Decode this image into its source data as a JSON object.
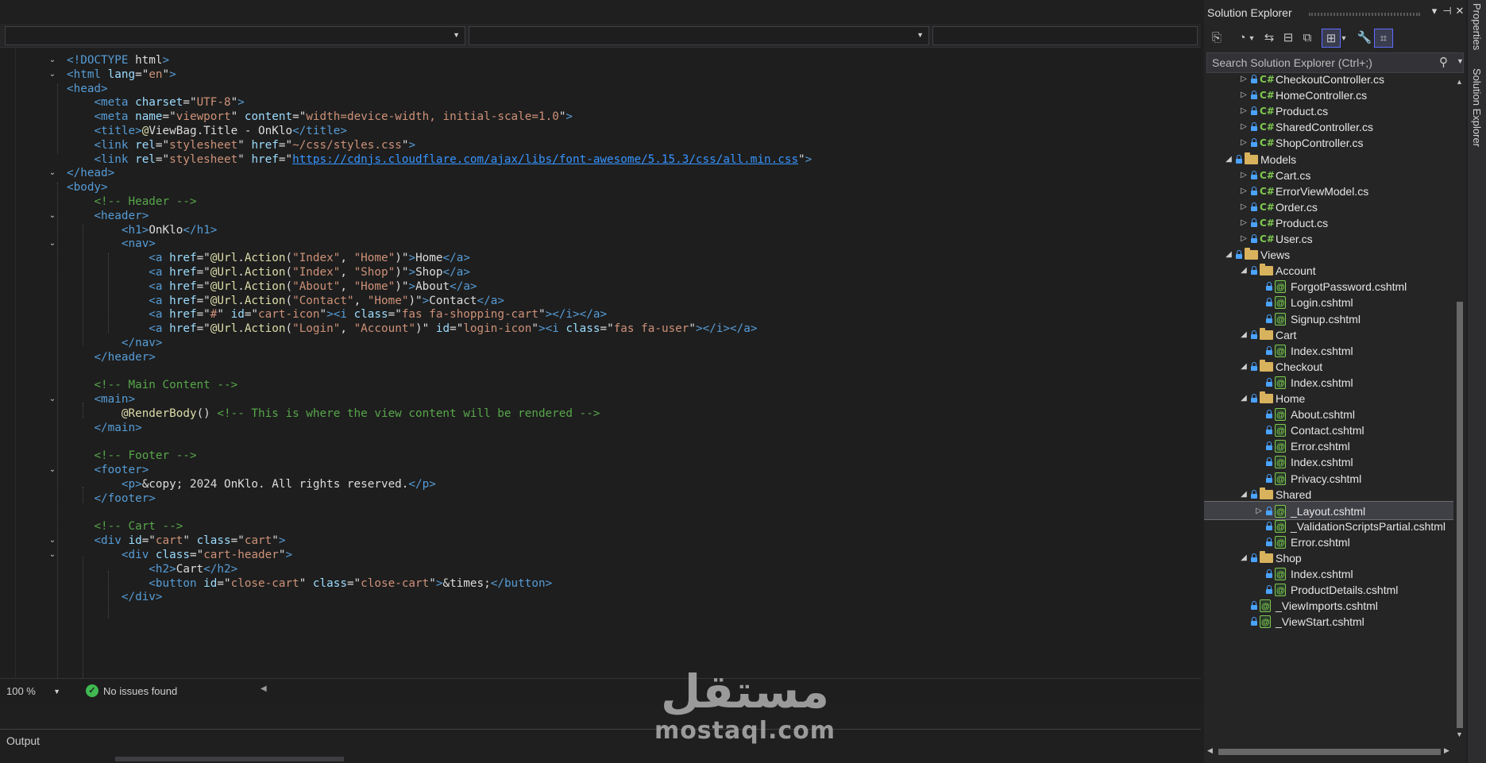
{
  "editor": {
    "nav_dropdowns": [
      "",
      "",
      ""
    ],
    "lines": [
      [
        [
          "t-tag",
          "<!DOCTYPE "
        ],
        [
          "t-txt",
          "html"
        ],
        [
          "t-tag",
          ">"
        ]
      ],
      [
        [
          "t-tag",
          "<html "
        ],
        [
          "t-attr",
          "lang"
        ],
        [
          "t-txt",
          "=\""
        ],
        [
          "t-str",
          "en"
        ],
        [
          "t-txt",
          "\""
        ],
        [
          "t-tag",
          ">"
        ]
      ],
      [
        [
          "t-tag",
          "<head>"
        ]
      ],
      [
        [
          "t-txt",
          "    "
        ],
        [
          "t-tag",
          "<meta "
        ],
        [
          "t-attr",
          "charset"
        ],
        [
          "t-txt",
          "=\""
        ],
        [
          "t-str",
          "UTF-8"
        ],
        [
          "t-txt",
          "\""
        ],
        [
          "t-tag",
          ">"
        ]
      ],
      [
        [
          "t-txt",
          "    "
        ],
        [
          "t-tag",
          "<meta "
        ],
        [
          "t-attr",
          "name"
        ],
        [
          "t-txt",
          "=\""
        ],
        [
          "t-str",
          "viewport"
        ],
        [
          "t-txt",
          "\" "
        ],
        [
          "t-attr",
          "content"
        ],
        [
          "t-txt",
          "=\""
        ],
        [
          "t-str",
          "width=device-width, initial-scale=1.0"
        ],
        [
          "t-txt",
          "\""
        ],
        [
          "t-tag",
          ">"
        ]
      ],
      [
        [
          "t-txt",
          "    "
        ],
        [
          "t-tag",
          "<title>"
        ],
        [
          "t-razor",
          "@"
        ],
        [
          "t-txt",
          "ViewBag.Title - OnKlo"
        ],
        [
          "t-tag",
          "</title>"
        ]
      ],
      [
        [
          "t-txt",
          "    "
        ],
        [
          "t-tag",
          "<link "
        ],
        [
          "t-attr",
          "rel"
        ],
        [
          "t-txt",
          "=\""
        ],
        [
          "t-str",
          "stylesheet"
        ],
        [
          "t-txt",
          "\" "
        ],
        [
          "t-attr",
          "href"
        ],
        [
          "t-txt",
          "=\""
        ],
        [
          "t-str",
          "~/css/styles.css"
        ],
        [
          "t-txt",
          "\""
        ],
        [
          "t-tag",
          ">"
        ]
      ],
      [
        [
          "t-txt",
          "    "
        ],
        [
          "t-tag",
          "<link "
        ],
        [
          "t-attr",
          "rel"
        ],
        [
          "t-txt",
          "=\""
        ],
        [
          "t-str",
          "stylesheet"
        ],
        [
          "t-txt",
          "\" "
        ],
        [
          "t-attr",
          "href"
        ],
        [
          "t-txt",
          "=\""
        ],
        [
          "t-link",
          "https://cdnjs.cloudflare.com/ajax/libs/font-awesome/5.15.3/css/all.min.css"
        ],
        [
          "t-txt",
          "\""
        ],
        [
          "t-tag",
          ">"
        ]
      ],
      [
        [
          "t-tag",
          "</head>"
        ]
      ],
      [
        [
          "t-tag",
          "<body>"
        ]
      ],
      [
        [
          "t-txt",
          "    "
        ],
        [
          "t-com",
          "<!-- Header -->"
        ]
      ],
      [
        [
          "t-txt",
          "    "
        ],
        [
          "t-tag",
          "<header>"
        ]
      ],
      [
        [
          "t-txt",
          "        "
        ],
        [
          "t-tag",
          "<h1>"
        ],
        [
          "t-txt",
          "OnKlo"
        ],
        [
          "t-tag",
          "</h1>"
        ]
      ],
      [
        [
          "t-txt",
          "        "
        ],
        [
          "t-tag",
          "<nav>"
        ]
      ],
      [
        [
          "t-txt",
          "            "
        ],
        [
          "t-tag",
          "<a "
        ],
        [
          "t-attr",
          "href"
        ],
        [
          "t-txt",
          "=\""
        ],
        [
          "t-razor",
          "@Url"
        ],
        [
          "t-txt",
          "."
        ],
        [
          "t-razor",
          "Action"
        ],
        [
          "t-txt",
          "("
        ],
        [
          "t-str",
          "\"Index\""
        ],
        [
          "t-txt",
          ", "
        ],
        [
          "t-str",
          "\"Home\""
        ],
        [
          "t-txt",
          ")\""
        ],
        [
          "t-tag",
          ">"
        ],
        [
          "t-txt",
          "Home"
        ],
        [
          "t-tag",
          "</a>"
        ]
      ],
      [
        [
          "t-txt",
          "            "
        ],
        [
          "t-tag",
          "<a "
        ],
        [
          "t-attr",
          "href"
        ],
        [
          "t-txt",
          "=\""
        ],
        [
          "t-razor",
          "@Url"
        ],
        [
          "t-txt",
          "."
        ],
        [
          "t-razor",
          "Action"
        ],
        [
          "t-txt",
          "("
        ],
        [
          "t-str",
          "\"Index\""
        ],
        [
          "t-txt",
          ", "
        ],
        [
          "t-str",
          "\"Shop\""
        ],
        [
          "t-txt",
          ")\""
        ],
        [
          "t-tag",
          ">"
        ],
        [
          "t-txt",
          "Shop"
        ],
        [
          "t-tag",
          "</a>"
        ]
      ],
      [
        [
          "t-txt",
          "            "
        ],
        [
          "t-tag",
          "<a "
        ],
        [
          "t-attr",
          "href"
        ],
        [
          "t-txt",
          "=\""
        ],
        [
          "t-razor",
          "@Url"
        ],
        [
          "t-txt",
          "."
        ],
        [
          "t-razor",
          "Action"
        ],
        [
          "t-txt",
          "("
        ],
        [
          "t-str",
          "\"About\""
        ],
        [
          "t-txt",
          ", "
        ],
        [
          "t-str",
          "\"Home\""
        ],
        [
          "t-txt",
          ")\""
        ],
        [
          "t-tag",
          ">"
        ],
        [
          "t-txt",
          "About"
        ],
        [
          "t-tag",
          "</a>"
        ]
      ],
      [
        [
          "t-txt",
          "            "
        ],
        [
          "t-tag",
          "<a "
        ],
        [
          "t-attr",
          "href"
        ],
        [
          "t-txt",
          "=\""
        ],
        [
          "t-razor",
          "@Url"
        ],
        [
          "t-txt",
          "."
        ],
        [
          "t-razor",
          "Action"
        ],
        [
          "t-txt",
          "("
        ],
        [
          "t-str",
          "\"Contact\""
        ],
        [
          "t-txt",
          ", "
        ],
        [
          "t-str",
          "\"Home\""
        ],
        [
          "t-txt",
          ")\""
        ],
        [
          "t-tag",
          ">"
        ],
        [
          "t-txt",
          "Contact"
        ],
        [
          "t-tag",
          "</a>"
        ]
      ],
      [
        [
          "t-txt",
          "            "
        ],
        [
          "t-tag",
          "<a "
        ],
        [
          "t-attr",
          "href"
        ],
        [
          "t-txt",
          "=\""
        ],
        [
          "t-str",
          "#"
        ],
        [
          "t-txt",
          "\" "
        ],
        [
          "t-attr",
          "id"
        ],
        [
          "t-txt",
          "=\""
        ],
        [
          "t-str",
          "cart-icon"
        ],
        [
          "t-txt",
          "\""
        ],
        [
          "t-tag",
          "><i "
        ],
        [
          "t-attr",
          "class"
        ],
        [
          "t-txt",
          "=\""
        ],
        [
          "t-str",
          "fas fa-shopping-cart"
        ],
        [
          "t-txt",
          "\""
        ],
        [
          "t-tag",
          "></i></a>"
        ]
      ],
      [
        [
          "t-txt",
          "            "
        ],
        [
          "t-tag",
          "<a "
        ],
        [
          "t-attr",
          "href"
        ],
        [
          "t-txt",
          "=\""
        ],
        [
          "t-razor",
          "@Url"
        ],
        [
          "t-txt",
          "."
        ],
        [
          "t-razor",
          "Action"
        ],
        [
          "t-txt",
          "("
        ],
        [
          "t-str",
          "\"Login\""
        ],
        [
          "t-txt",
          ", "
        ],
        [
          "t-str",
          "\"Account\""
        ],
        [
          "t-txt",
          ")\" "
        ],
        [
          "t-attr",
          "id"
        ],
        [
          "t-txt",
          "=\""
        ],
        [
          "t-str",
          "login-icon"
        ],
        [
          "t-txt",
          "\""
        ],
        [
          "t-tag",
          "><i "
        ],
        [
          "t-attr",
          "class"
        ],
        [
          "t-txt",
          "=\""
        ],
        [
          "t-str",
          "fas fa-user"
        ],
        [
          "t-txt",
          "\""
        ],
        [
          "t-tag",
          "></i></a>"
        ]
      ],
      [
        [
          "t-txt",
          "        "
        ],
        [
          "t-tag",
          "</nav>"
        ]
      ],
      [
        [
          "t-txt",
          "    "
        ],
        [
          "t-tag",
          "</header>"
        ]
      ],
      [
        [
          "t-txt",
          ""
        ]
      ],
      [
        [
          "t-txt",
          "    "
        ],
        [
          "t-com",
          "<!-- Main Content -->"
        ]
      ],
      [
        [
          "t-txt",
          "    "
        ],
        [
          "t-tag",
          "<main>"
        ]
      ],
      [
        [
          "t-txt",
          "        "
        ],
        [
          "t-razor",
          "@RenderBody"
        ],
        [
          "t-txt",
          "() "
        ],
        [
          "t-com",
          "<!-- This is where the view content will be rendered -->"
        ]
      ],
      [
        [
          "t-txt",
          "    "
        ],
        [
          "t-tag",
          "</main>"
        ]
      ],
      [
        [
          "t-txt",
          ""
        ]
      ],
      [
        [
          "t-txt",
          "    "
        ],
        [
          "t-com",
          "<!-- Footer -->"
        ]
      ],
      [
        [
          "t-txt",
          "    "
        ],
        [
          "t-tag",
          "<footer>"
        ]
      ],
      [
        [
          "t-txt",
          "        "
        ],
        [
          "t-tag",
          "<p>"
        ],
        [
          "t-txt",
          "&copy; 2024 OnKlo. All rights reserved."
        ],
        [
          "t-tag",
          "</p>"
        ]
      ],
      [
        [
          "t-txt",
          "    "
        ],
        [
          "t-tag",
          "</footer>"
        ]
      ],
      [
        [
          "t-txt",
          ""
        ]
      ],
      [
        [
          "t-txt",
          "    "
        ],
        [
          "t-com",
          "<!-- Cart -->"
        ]
      ],
      [
        [
          "t-txt",
          "    "
        ],
        [
          "t-tag",
          "<div "
        ],
        [
          "t-attr",
          "id"
        ],
        [
          "t-txt",
          "=\""
        ],
        [
          "t-str",
          "cart"
        ],
        [
          "t-txt",
          "\" "
        ],
        [
          "t-attr",
          "class"
        ],
        [
          "t-txt",
          "=\""
        ],
        [
          "t-str",
          "cart"
        ],
        [
          "t-txt",
          "\""
        ],
        [
          "t-tag",
          ">"
        ]
      ],
      [
        [
          "t-txt",
          "        "
        ],
        [
          "t-tag",
          "<div "
        ],
        [
          "t-attr",
          "class"
        ],
        [
          "t-txt",
          "=\""
        ],
        [
          "t-str",
          "cart-header"
        ],
        [
          "t-txt",
          "\""
        ],
        [
          "t-tag",
          ">"
        ]
      ],
      [
        [
          "t-txt",
          "            "
        ],
        [
          "t-tag",
          "<h2>"
        ],
        [
          "t-txt",
          "Cart"
        ],
        [
          "t-tag",
          "</h2>"
        ]
      ],
      [
        [
          "t-txt",
          "            "
        ],
        [
          "t-tag",
          "<button "
        ],
        [
          "t-attr",
          "id"
        ],
        [
          "t-txt",
          "=\""
        ],
        [
          "t-str",
          "close-cart"
        ],
        [
          "t-txt",
          "\" "
        ],
        [
          "t-attr",
          "class"
        ],
        [
          "t-txt",
          "=\""
        ],
        [
          "t-str",
          "close-cart"
        ],
        [
          "t-txt",
          "\""
        ],
        [
          "t-tag",
          ">"
        ],
        [
          "t-txt",
          "&times;"
        ],
        [
          "t-tag",
          "</button>"
        ]
      ],
      [
        [
          "t-txt",
          "        "
        ],
        [
          "t-tag",
          "</div>"
        ]
      ]
    ],
    "fold_markers": [
      "⌄",
      "⌄",
      "",
      "",
      "",
      "",
      "",
      "",
      "⌄",
      "",
      "",
      "⌄",
      "",
      "⌄",
      "",
      "",
      "",
      "",
      "",
      "",
      "",
      "",
      "",
      "",
      "⌄",
      "",
      "",
      "",
      "",
      "⌄",
      "",
      "",
      "",
      "",
      "⌄",
      "⌄",
      "",
      ""
    ],
    "zoom": "100 %",
    "status": "No issues found"
  },
  "output": {
    "title": "Output"
  },
  "solution_explorer": {
    "title": "Solution Explorer",
    "search_placeholder": "Search Solution Explorer (Ctrl+;)",
    "items": [
      {
        "label": "CheckoutController.cs",
        "type": "cs",
        "level": 2,
        "expander": "▷"
      },
      {
        "label": "HomeController.cs",
        "type": "cs",
        "level": 2,
        "expander": "▷"
      },
      {
        "label": "Product.cs",
        "type": "cs",
        "level": 2,
        "expander": "▷",
        "pending": true
      },
      {
        "label": "SharedController.cs",
        "type": "cs",
        "level": 2,
        "expander": "▷"
      },
      {
        "label": "ShopController.cs",
        "type": "cs",
        "level": 2,
        "expander": "▷"
      },
      {
        "label": "Models",
        "type": "folder",
        "level": 1,
        "expander": "◢"
      },
      {
        "label": "Cart.cs",
        "type": "cs",
        "level": 2,
        "expander": "▷"
      },
      {
        "label": "ErrorViewModel.cs",
        "type": "cs",
        "level": 2,
        "expander": "▷"
      },
      {
        "label": "Order.cs",
        "type": "cs",
        "level": 2,
        "expander": "▷"
      },
      {
        "label": "Product.cs",
        "type": "cs",
        "level": 2,
        "expander": "▷"
      },
      {
        "label": "User.cs",
        "type": "cs",
        "level": 2,
        "expander": "▷"
      },
      {
        "label": "Views",
        "type": "folder",
        "level": 1,
        "expander": "◢"
      },
      {
        "label": "Account",
        "type": "folder",
        "level": 2,
        "expander": "◢"
      },
      {
        "label": "ForgotPassword.cshtml",
        "type": "cshtml",
        "level": 3,
        "expander": ""
      },
      {
        "label": "Login.cshtml",
        "type": "cshtml",
        "level": 3,
        "expander": ""
      },
      {
        "label": "Signup.cshtml",
        "type": "cshtml",
        "level": 3,
        "expander": ""
      },
      {
        "label": "Cart",
        "type": "folder",
        "level": 2,
        "expander": "◢"
      },
      {
        "label": "Index.cshtml",
        "type": "cshtml",
        "level": 3,
        "expander": ""
      },
      {
        "label": "Checkout",
        "type": "folder",
        "level": 2,
        "expander": "◢"
      },
      {
        "label": "Index.cshtml",
        "type": "cshtml",
        "level": 3,
        "expander": ""
      },
      {
        "label": "Home",
        "type": "folder",
        "level": 2,
        "expander": "◢"
      },
      {
        "label": "About.cshtml",
        "type": "cshtml",
        "level": 3,
        "expander": ""
      },
      {
        "label": "Contact.cshtml",
        "type": "cshtml",
        "level": 3,
        "expander": ""
      },
      {
        "label": "Error.cshtml",
        "type": "cshtml",
        "level": 3,
        "expander": ""
      },
      {
        "label": "Index.cshtml",
        "type": "cshtml",
        "level": 3,
        "expander": ""
      },
      {
        "label": "Privacy.cshtml",
        "type": "cshtml",
        "level": 3,
        "expander": ""
      },
      {
        "label": "Shared",
        "type": "folder",
        "level": 2,
        "expander": "◢"
      },
      {
        "label": "_Layout.cshtml",
        "type": "cshtml",
        "level": 3,
        "expander": "▷",
        "selected": true
      },
      {
        "label": "_ValidationScriptsPartial.cshtml",
        "type": "cshtml",
        "level": 3,
        "expander": ""
      },
      {
        "label": "Error.cshtml",
        "type": "cshtml",
        "level": 3,
        "expander": ""
      },
      {
        "label": "Shop",
        "type": "folder",
        "level": 2,
        "expander": "◢"
      },
      {
        "label": "Index.cshtml",
        "type": "cshtml",
        "level": 3,
        "expander": ""
      },
      {
        "label": "ProductDetails.cshtml",
        "type": "cshtml",
        "level": 3,
        "expander": ""
      },
      {
        "label": "_ViewImports.cshtml",
        "type": "cshtml",
        "level": 2,
        "expander": ""
      },
      {
        "label": "_ViewStart.cshtml",
        "type": "cshtml",
        "level": 2,
        "expander": ""
      }
    ]
  },
  "side_tabs": {
    "properties": "Properties",
    "solution_explorer": "Solution Explorer"
  },
  "watermark": {
    "arabic": "مستقل",
    "latin": "mostaql.com"
  },
  "colors": {
    "tag": "#569cd6",
    "attr": "#9cdcfe",
    "string": "#ce9178",
    "comment": "#57a64a",
    "razor": "#dcdcaa",
    "link": "#3794ff",
    "cs_icon": "#7ec850",
    "folder": "#d8b25c",
    "lock": "#4aa3ff"
  }
}
